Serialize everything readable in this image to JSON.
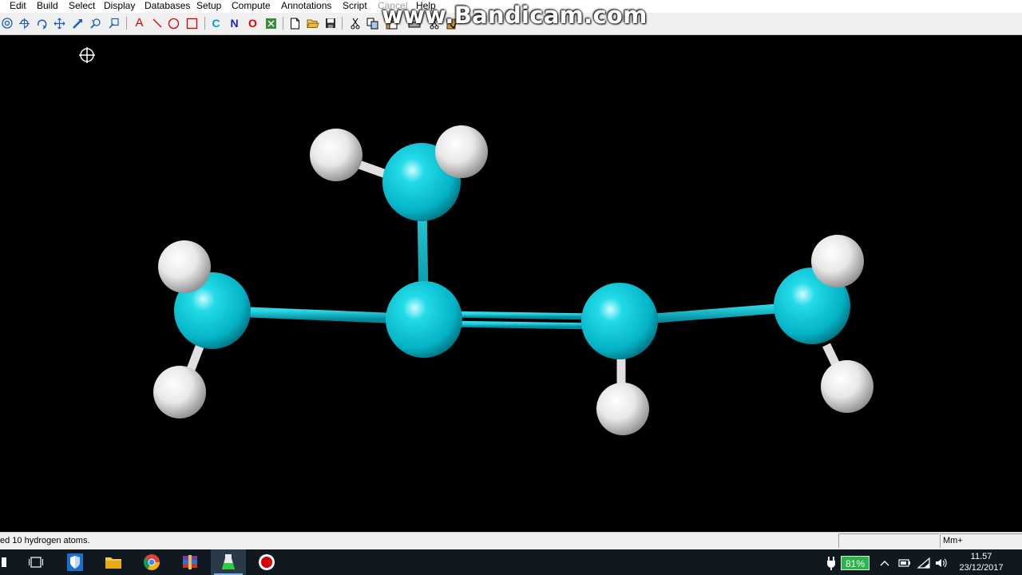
{
  "menu": {
    "items": [
      "Edit",
      "Build",
      "Select",
      "Display",
      "Databases",
      "Setup",
      "Compute",
      "Annotations",
      "Script",
      "Cancel",
      "Help"
    ],
    "disabled": [
      "Cancel"
    ]
  },
  "toolbar": {
    "tools": [
      "select-circle-icon",
      "rotate-xy-icon",
      "rotate-z-icon",
      "translate-icon",
      "draw-arrow-icon",
      "magnify-icon",
      "zoom-icon"
    ],
    "annotations": [
      "A",
      "line-icon",
      "ellipse-icon",
      "rectangle-icon"
    ],
    "elements": [
      "C",
      "N",
      "O"
    ],
    "element_colors": {
      "C": "#00a0c8",
      "N": "#2020c0",
      "O": "#e00000"
    },
    "file_tools": [
      "new-file-icon",
      "open-folder-icon",
      "save-icon",
      "cut-icon",
      "copy-icon",
      "paste-icon",
      "print-icon",
      "cut2-icon",
      "paste2-icon"
    ]
  },
  "watermark": "www.Bandicam.com",
  "molecule": {
    "carbon_color": "#1cc4d4",
    "hydrogen_color": "#f0f0f0",
    "background": "#000000"
  },
  "status": {
    "message": "ed 10 hydrogen atoms.",
    "mode": "Mm+"
  },
  "taskbar": {
    "battery": "81%",
    "time": "11.57",
    "date": "23/12/2017"
  }
}
